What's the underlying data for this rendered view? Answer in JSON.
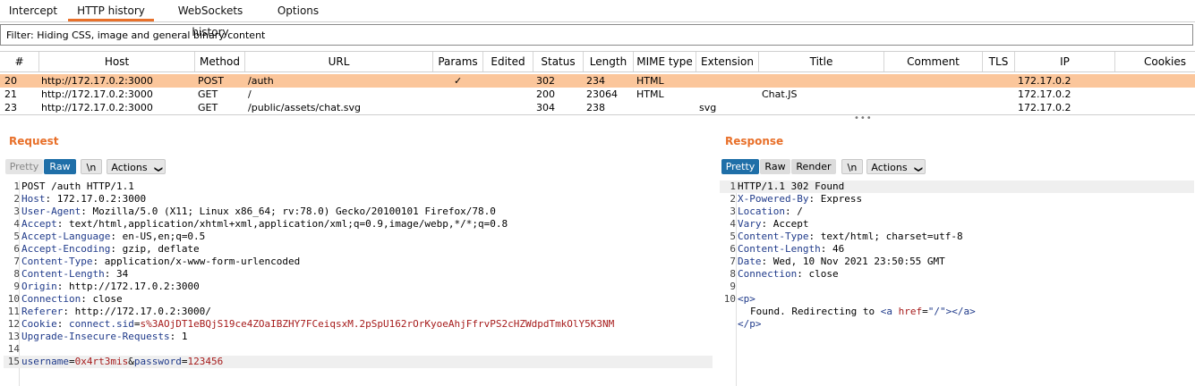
{
  "tabs": [
    {
      "label": "Intercept"
    },
    {
      "label": "HTTP history"
    },
    {
      "label": "WebSockets history"
    },
    {
      "label": "Options"
    }
  ],
  "filter": "Filter: Hiding CSS, image and general binary content",
  "columns": [
    "#",
    "Host",
    "Method",
    "URL",
    "Params",
    "Edited",
    "Status",
    "Length",
    "MIME type",
    "Extension",
    "Title",
    "Comment",
    "TLS",
    "IP",
    "Cookies"
  ],
  "rows": [
    {
      "num": "20",
      "host": "http://172.17.0.2:3000",
      "method": "POST",
      "url": "/auth",
      "params": "✓",
      "status": "302",
      "length": "234",
      "mime": "HTML",
      "ext": "",
      "title": "",
      "ip": "172.17.0.2"
    },
    {
      "num": "21",
      "host": "http://172.17.0.2:3000",
      "method": "GET",
      "url": "/",
      "params": "",
      "status": "200",
      "length": "23064",
      "mime": "HTML",
      "ext": "",
      "title": "Chat.JS",
      "ip": "172.17.0.2"
    },
    {
      "num": "23",
      "host": "http://172.17.0.2:3000",
      "method": "GET",
      "url": "/public/assets/chat.svg",
      "params": "",
      "status": "304",
      "length": "238",
      "mime": "",
      "ext": "svg",
      "title": "",
      "ip": "172.17.0.2"
    }
  ],
  "request": {
    "title": "Request",
    "buttons": {
      "pretty": "Pretty",
      "raw": "Raw",
      "newline": "\\n",
      "actions": "Actions"
    },
    "lines": [
      {
        "key": "POST /auth HTTP/1.1",
        "val": ""
      },
      {
        "key": "Host",
        "val": ": 172.17.0.2:3000"
      },
      {
        "key": "User-Agent",
        "val": ": Mozilla/5.0 (X11; Linux x86_64; rv:78.0) Gecko/20100101 Firefox/78.0"
      },
      {
        "key": "Accept",
        "val": ": text/html,application/xhtml+xml,application/xml;q=0.9,image/webp,*/*;q=0.8"
      },
      {
        "key": "Accept-Language",
        "val": ": en-US,en;q=0.5"
      },
      {
        "key": "Accept-Encoding",
        "val": ": gzip, deflate"
      },
      {
        "key": "Content-Type",
        "val": ": application/x-www-form-urlencoded"
      },
      {
        "key": "Content-Length",
        "val": ": 34"
      },
      {
        "key": "Origin",
        "val": ": http://172.17.0.2:3000"
      },
      {
        "key": "Connection",
        "val": ": close"
      },
      {
        "key": "Referer",
        "val": ": http://172.17.0.2:3000/"
      },
      {
        "key": "Cookie",
        "val": ": ",
        "c_name": "connect.sid",
        "c_eq": "=",
        "c_val": "s%3AOjDT1eBQjS19ce4ZOaIBZHY7FCeiqsxM.2pSpU162rOrKyoeAhjFfrvPS2cHZWdpdTmkOlY5K3NM"
      },
      {
        "key": "Upgrade-Insecure-Requests",
        "val": ": 1"
      },
      {
        "key": "",
        "val": ""
      },
      {
        "key": "username",
        "val": "",
        "body": {
          "u_eq": "=",
          "u_val": "0x4rt3mis",
          "amp": "&",
          "p_key": "password",
          "p_eq": "=",
          "p_val": "123456"
        }
      }
    ]
  },
  "response": {
    "title": "Response",
    "buttons": {
      "pretty": "Pretty",
      "raw": "Raw",
      "render": "Render",
      "newline": "\\n",
      "actions": "Actions"
    },
    "lines": [
      {
        "key": "HTTP/1.1 302 Found",
        "val": ""
      },
      {
        "key": "X-Powered-By",
        "val": ": Express"
      },
      {
        "key": "Location",
        "val": ": /"
      },
      {
        "key": "Vary",
        "val": ": Accept"
      },
      {
        "key": "Content-Type",
        "val": ": text/html; charset=utf-8"
      },
      {
        "key": "Content-Length",
        "val": ": 46"
      },
      {
        "key": "Date",
        "val": ": Wed, 10 Nov 2021 23:50:55 GMT"
      },
      {
        "key": "Connection",
        "val": ": close"
      },
      {
        "key": "",
        "val": ""
      }
    ],
    "html_p_open": "<p>",
    "html_text": "Found. Redirecting to ",
    "html_a_open": "<a ",
    "html_href_attr": "href",
    "html_href_eq": "=",
    "html_href_val": "\"/\"",
    "html_a_close_tag": "></a>",
    "html_p_close": "</p>",
    "line10": "10"
  },
  "colors": {
    "accent": "#e8702a",
    "selected_row": "#fbc69b",
    "header_key": "#1f3a8a",
    "value_red": "#a61b1b"
  }
}
